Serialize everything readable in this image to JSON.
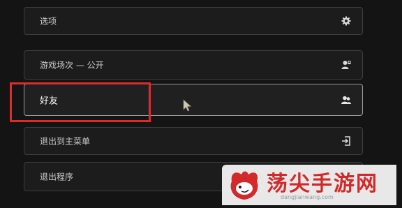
{
  "menu": {
    "items": [
      {
        "label": "选项",
        "icon": "gear-icon"
      },
      {
        "label": "游戏场次 — 公开",
        "icon": "person-lock-icon"
      },
      {
        "label": "好友",
        "icon": "friends-icon"
      },
      {
        "label": "退出到主菜单",
        "icon": "exit-door-icon"
      },
      {
        "label": "退出程序",
        "icon": "power-icon"
      }
    ],
    "selected_index": 2
  },
  "highlight": {
    "color": "#e02a2a"
  },
  "watermark": {
    "text": "荡尖手游网",
    "url": "dangjianwang.com",
    "color": "#d22a2a"
  }
}
